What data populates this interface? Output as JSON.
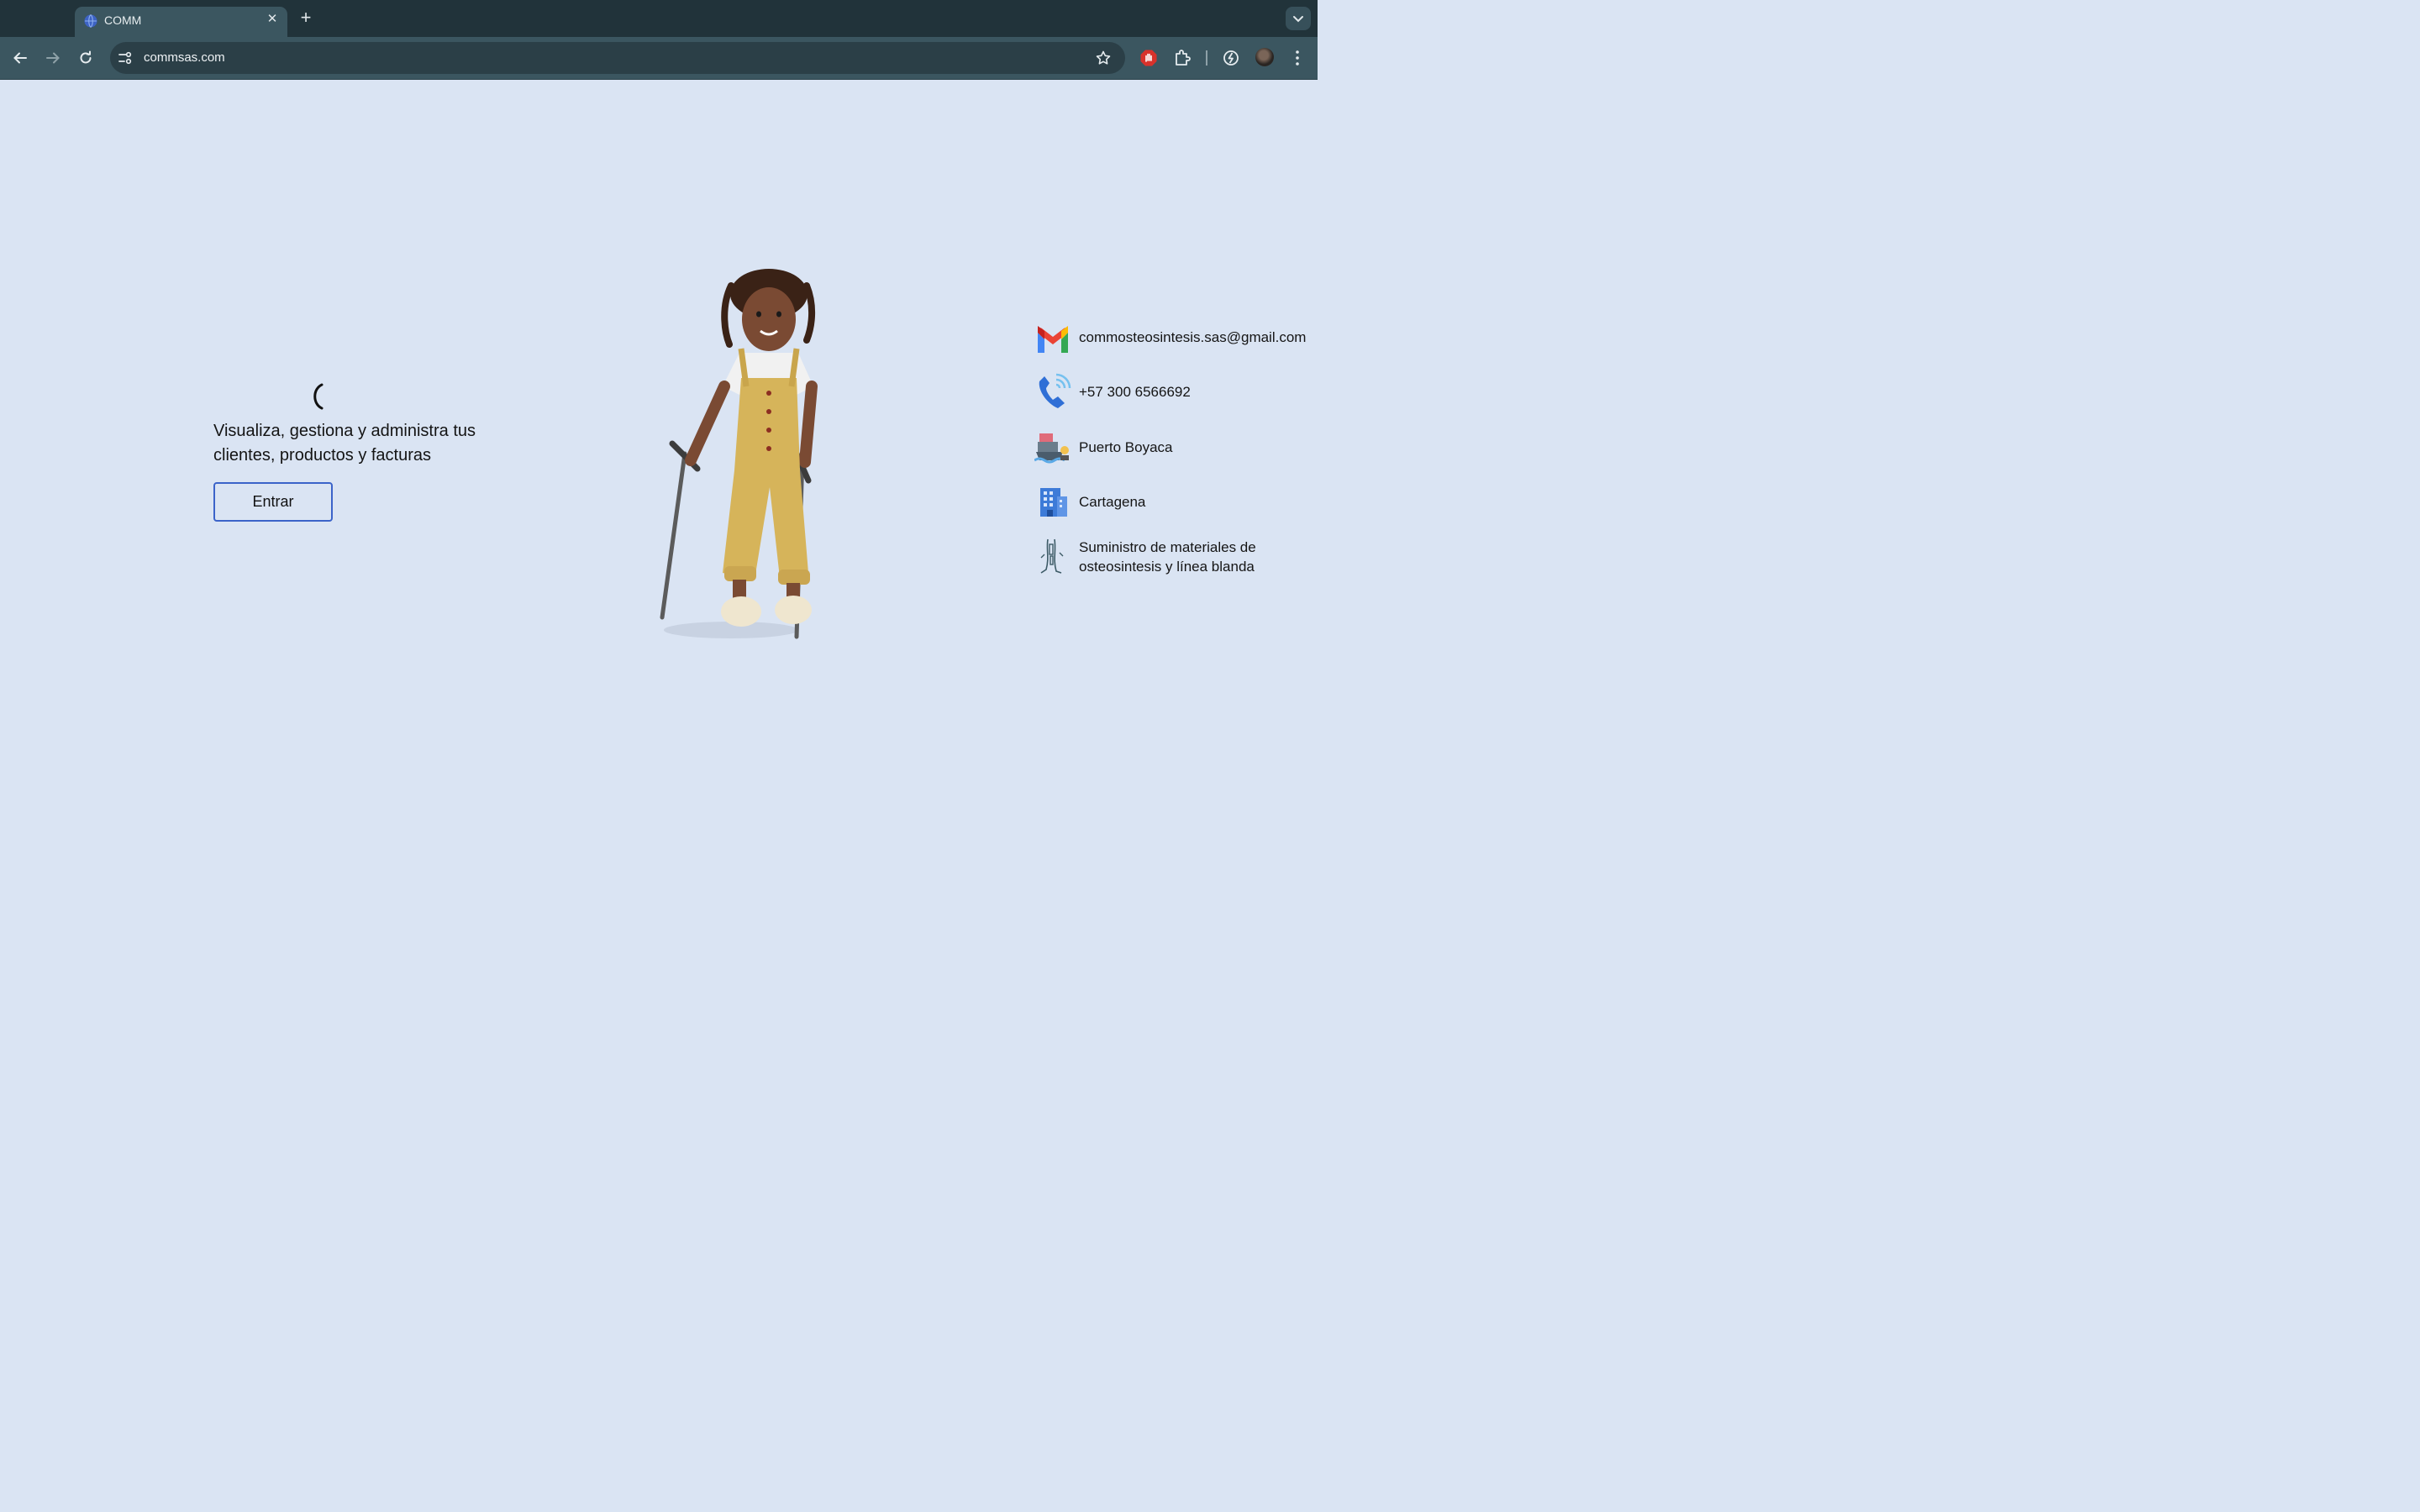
{
  "browser": {
    "tab": {
      "title": "COMM",
      "favicon": "globe-icon"
    },
    "url": "commsas.com",
    "toolbar_icons": [
      "back-icon",
      "forward-icon",
      "reload-icon",
      "site-info-icon",
      "bookmark-star-icon",
      "adblock-icon",
      "extensions-icon",
      "sync-icon",
      "avatar",
      "menu-icon"
    ]
  },
  "hero": {
    "spinner": "(",
    "tagline": "Visualiza, gestiona y administra tus clientes, productos y facturas",
    "enter_label": "Entrar"
  },
  "contacts": {
    "email": "commosteosintesis.sas@gmail.com",
    "phone": "+57 300 6566692",
    "location_1": "Puerto Boyaca",
    "location_2": "Cartagena",
    "service": "Suministro de materiales de osteosintesis y línea blanda"
  },
  "colors": {
    "page_bg": "#dae4f3",
    "button_border": "#3b63c9",
    "chrome_dark": "#21333a",
    "chrome_tab": "#3b5660"
  }
}
